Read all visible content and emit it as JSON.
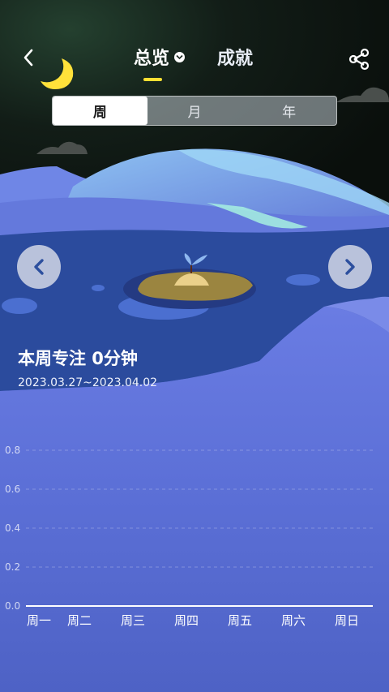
{
  "header": {
    "back_icon": "chevron-left-icon",
    "tab_overview": "总览",
    "tab_overview_icon": "chevron-down-circle-icon",
    "tab_achievements": "成就",
    "share_icon": "share-icon",
    "moon_icon": "crescent-moon-icon"
  },
  "period_selector": {
    "options": [
      "周",
      "月",
      "年"
    ],
    "selected": "周"
  },
  "navigation": {
    "prev_icon": "chevron-left-icon",
    "next_icon": "chevron-right-icon"
  },
  "summary": {
    "title": "本周专注 0分钟",
    "date_range": "2023.03.27~2023.04.02"
  },
  "colors": {
    "accent_underline": "#ffe033",
    "sky": "#0f1712",
    "water": "#2a4ba0",
    "chart_bg": "#5a6fd8"
  },
  "chart_data": {
    "type": "bar",
    "categories": [
      "周一",
      "周二",
      "周三",
      "周四",
      "周五",
      "周六",
      "周日"
    ],
    "values": [
      0,
      0,
      0,
      0,
      0,
      0,
      0
    ],
    "ylim": [
      0,
      0.8
    ],
    "yticks": [
      "0.0",
      "0.2",
      "0.4",
      "0.6",
      "0.8"
    ],
    "grid": true
  }
}
